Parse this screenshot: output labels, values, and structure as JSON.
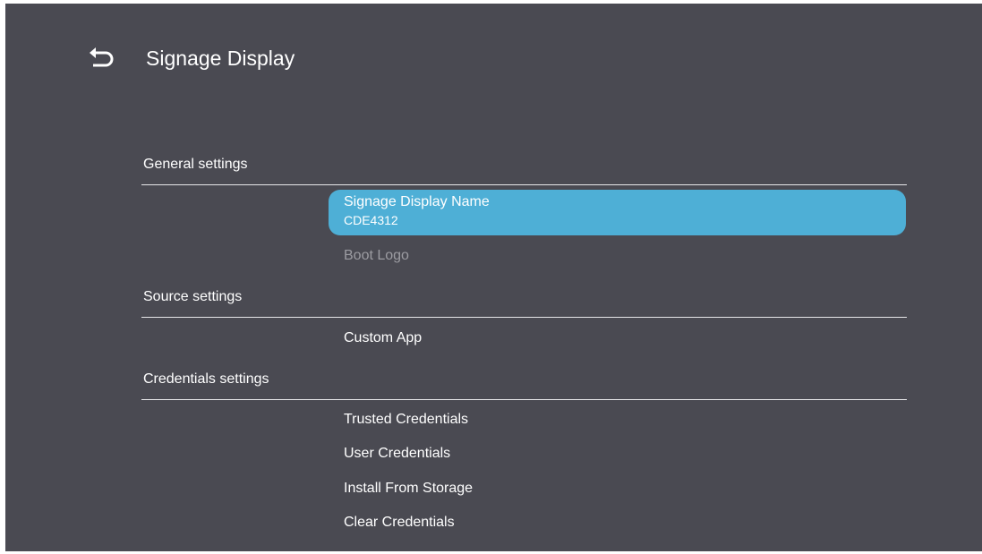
{
  "header": {
    "title": "Signage Display",
    "back_icon": "back-arrow-icon"
  },
  "general": {
    "header": "General settings",
    "display_name": {
      "label": "Signage Display Name",
      "value": "CDE4312"
    },
    "boot_logo": "Boot Logo"
  },
  "source": {
    "header": "Source settings",
    "custom_app": "Custom App"
  },
  "credentials": {
    "header": "Credentials settings",
    "trusted": "Trusted Credentials",
    "user": "User Credentials",
    "install": "Install From Storage",
    "clear": "Clear Credentials"
  },
  "colors": {
    "background": "#4a4a52",
    "highlight": "#4eafd6",
    "text": "#ffffff",
    "disabled_text": "#9c9ca2"
  }
}
